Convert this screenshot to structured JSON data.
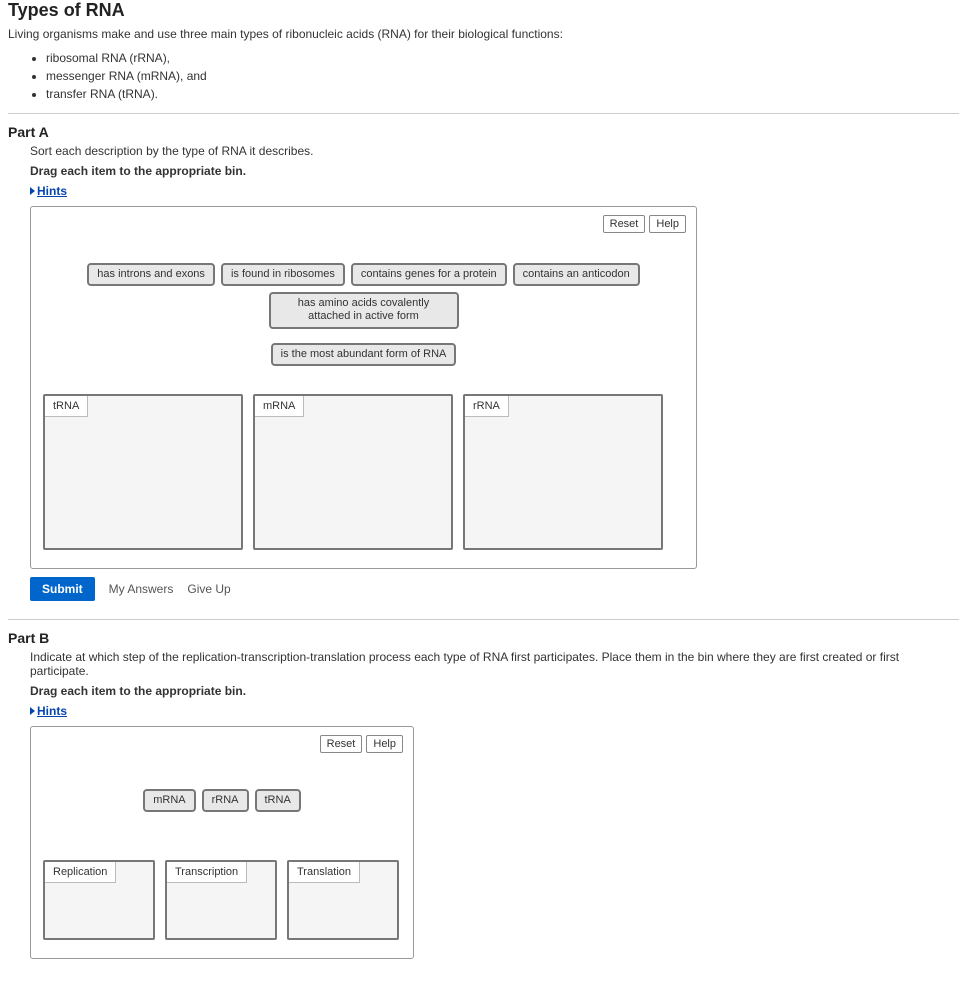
{
  "header": {
    "title": "Types of RNA",
    "intro": "Living organisms make and use three main types of ribonucleic acids (RNA) for their biological functions:",
    "list": [
      "ribosomal RNA (rRNA),",
      "messenger RNA (mRNA), and",
      "transfer RNA (tRNA)."
    ]
  },
  "common": {
    "hints": "Hints",
    "reset": "Reset",
    "help": "Help",
    "submit": "Submit",
    "my_answers": "My Answers",
    "give_up": "Give Up",
    "drag_instruction": "Drag each item to the appropriate bin."
  },
  "partA": {
    "heading": "Part A",
    "instruction": "Sort each description by the type of RNA it describes.",
    "items": [
      "has introns and exons",
      "is found in ribosomes",
      "contains genes for a protein",
      "contains an anticodon",
      "has amino acids covalently attached in active form",
      "is the most abundant form of RNA"
    ],
    "bins": [
      "tRNA",
      "mRNA",
      "rRNA"
    ]
  },
  "partB": {
    "heading": "Part B",
    "instruction": "Indicate at which step of the replication-transcription-translation process each type of RNA first participates. Place them in the bin where they are first created or first participate.",
    "items": [
      "mRNA",
      "rRNA",
      "tRNA"
    ],
    "bins": [
      "Replication",
      "Transcription",
      "Translation"
    ]
  }
}
